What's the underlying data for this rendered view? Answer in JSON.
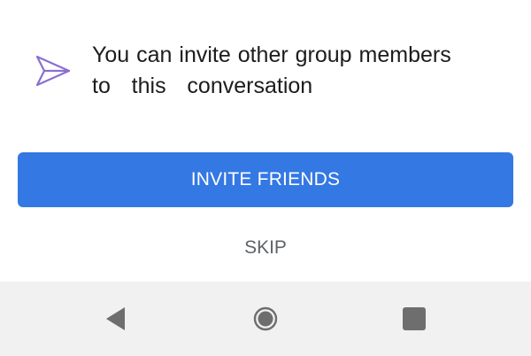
{
  "info": {
    "icon": "send-icon",
    "line1": "You can invite other group members",
    "line2": "to   this   conversation"
  },
  "actions": {
    "invite_label": "INVITE FRIENDS",
    "skip_label": "SKIP"
  },
  "navbar": {
    "back": "back-icon",
    "home": "home-icon",
    "recents": "recents-icon"
  },
  "colors": {
    "accent": "#3478e3",
    "icon_purple": "#8b6fd0",
    "nav_bg": "#f1f1f1",
    "nav_icon": "#6e6e6e",
    "skip_text": "#5f6368"
  }
}
